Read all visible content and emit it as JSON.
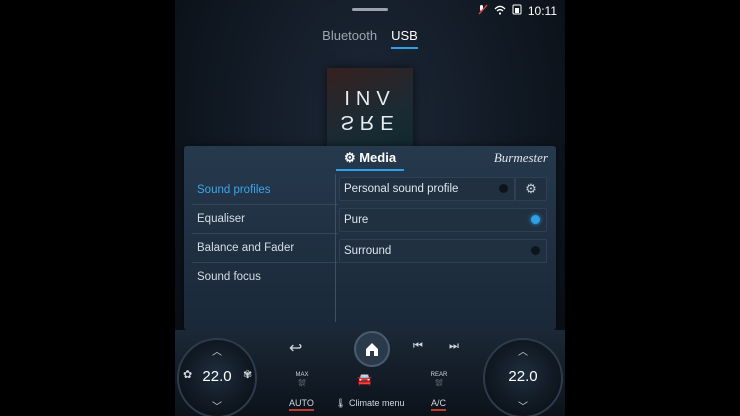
{
  "status": {
    "time": "10:11",
    "icons": [
      "mute-icon",
      "wifi-icon",
      "battery-icon"
    ]
  },
  "source_tabs": [
    {
      "label": "Bluetooth",
      "active": false
    },
    {
      "label": "USB",
      "active": true
    }
  ],
  "album_cover": {
    "line1": "INV",
    "line2": "SRE"
  },
  "panel": {
    "title": "Media",
    "brand": "Burmester",
    "menu": [
      {
        "label": "Sound profiles",
        "selected": true
      },
      {
        "label": "Equaliser",
        "selected": false
      },
      {
        "label": "Balance and Fader",
        "selected": false
      },
      {
        "label": "Sound focus",
        "selected": false
      }
    ],
    "options": [
      {
        "label": "Personal sound profile",
        "selected": false
      },
      {
        "label": "Pure",
        "selected": true
      },
      {
        "label": "Surround",
        "selected": false
      }
    ]
  },
  "climate": {
    "left_temp": "22.0",
    "right_temp": "22.0",
    "auto_label": "AUTO",
    "climate_menu_label": "Climate menu",
    "ac_label": "A/C",
    "max_label": "MAX",
    "rear_label": "REAR"
  },
  "colors": {
    "accent": "#2fa0e8",
    "warning": "#c0392b"
  }
}
